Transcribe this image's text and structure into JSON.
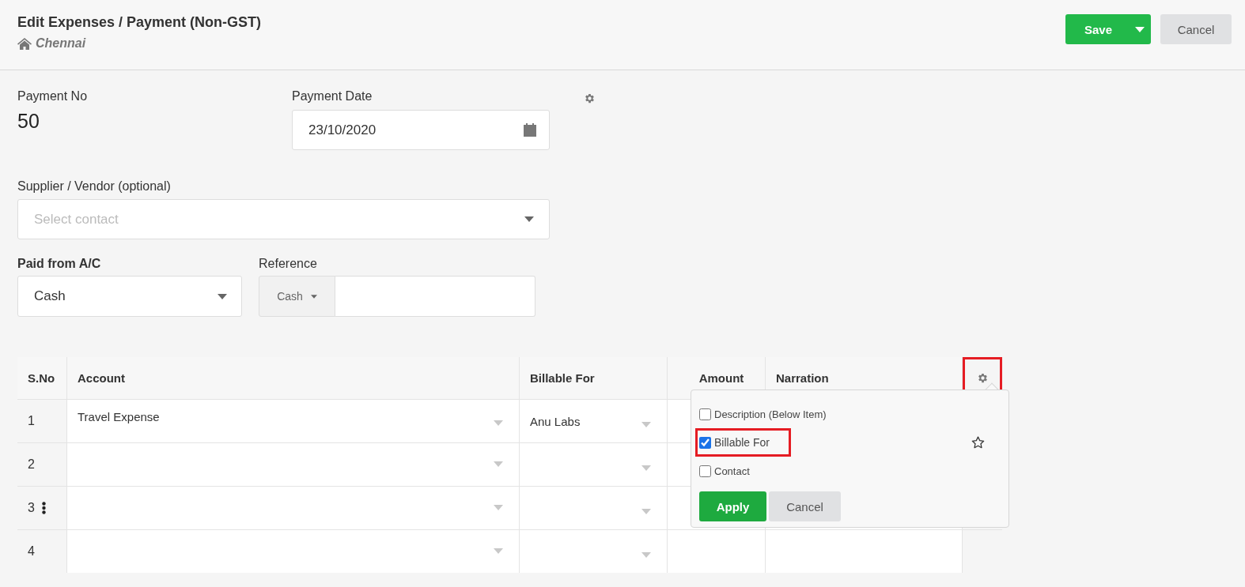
{
  "header": {
    "title": "Edit Expenses / Payment (Non-GST)",
    "branch": "Chennai",
    "save_button": "Save",
    "cancel_button": "Cancel"
  },
  "form": {
    "payment_no_label": "Payment No",
    "payment_no": "50",
    "payment_date_label": "Payment Date",
    "payment_date": "23/10/2020",
    "supplier_label": "Supplier / Vendor (optional)",
    "supplier_placeholder": "Select contact",
    "paid_from_label": "Paid from A/C",
    "paid_from": "Cash",
    "reference_label": "Reference",
    "reference_mode": "Cash"
  },
  "table": {
    "columns": [
      {
        "label": "S.No"
      },
      {
        "label": "Account"
      },
      {
        "label": "Billable For"
      },
      {
        "label": "Amount"
      },
      {
        "label": "Narration"
      }
    ],
    "settings_highlighted": true,
    "rows": [
      {
        "sno": "1",
        "account": "Travel Expense",
        "billable_for": "Anu Labs",
        "row_menu": false
      },
      {
        "sno": "2",
        "account": "",
        "billable_for": "",
        "row_menu": false
      },
      {
        "sno": "3",
        "account": "",
        "billable_for": "",
        "row_menu": true
      },
      {
        "sno": "4",
        "account": "",
        "billable_for": "",
        "row_menu": false
      }
    ]
  },
  "column_popup": {
    "options": [
      {
        "label": "Description (Below Item)",
        "checked": false,
        "highlighted": false,
        "star": false
      },
      {
        "label": "Billable For",
        "checked": true,
        "highlighted": true,
        "star": true
      },
      {
        "label": "Contact",
        "checked": false,
        "highlighted": false,
        "star": false
      }
    ],
    "apply_button": "Apply",
    "cancel_button": "Cancel"
  }
}
